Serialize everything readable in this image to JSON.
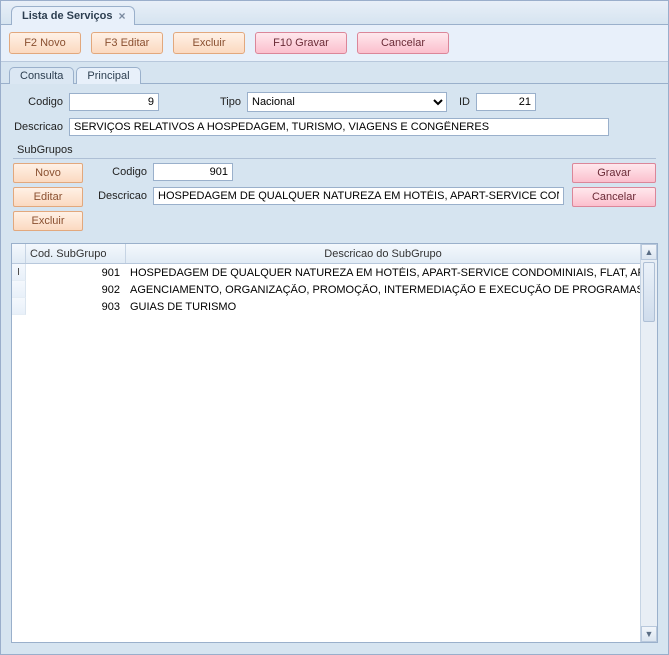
{
  "window": {
    "title": "Lista de Serviços"
  },
  "toolbar": {
    "f2novo": "F2 Novo",
    "f3editar": "F3 Editar",
    "excluir": "Excluir",
    "f10gravar": "F10 Gravar",
    "cancelar": "Cancelar"
  },
  "tabs": {
    "consulta": "Consulta",
    "principal": "Principal"
  },
  "form": {
    "codigo_label": "Codigo",
    "codigo_value": "9",
    "tipo_label": "Tipo",
    "tipo_value": "Nacional",
    "id_label": "ID",
    "id_value": "21",
    "descricao_label": "Descricao",
    "descricao_value": "SERVIÇOS RELATIVOS A HOSPEDAGEM, TURISMO, VIAGENS E CONGÊNERES"
  },
  "subgrupos": {
    "header": "SubGrupos",
    "novo": "Novo",
    "editar": "Editar",
    "excluir": "Excluir",
    "gravar": "Gravar",
    "cancelar": "Cancelar",
    "codigo_label": "Codigo",
    "codigo_value": "901",
    "descricao_label": "Descricao",
    "descricao_value": "HOSPEDAGEM DE QUALQUER NATUREZA EM HOTÉIS, APART-SERVICE CONDOMINIA"
  },
  "grid": {
    "col_cod": "Cod. SubGrupo",
    "col_desc": "Descricao do SubGrupo",
    "rows": [
      {
        "cod": "901",
        "desc": "HOSPEDAGEM DE QUALQUER NATUREZA EM HOTÉIS, APART-SERVICE CONDOMINIAIS, FLAT, APART-H"
      },
      {
        "cod": "902",
        "desc": "AGENCIAMENTO, ORGANIZAÇÃO, PROMOÇÃO, INTERMEDIAÇÃO E EXECUÇÃO DE PROGRAMAS DE TU"
      },
      {
        "cod": "903",
        "desc": "GUIAS DE TURISMO"
      }
    ]
  }
}
